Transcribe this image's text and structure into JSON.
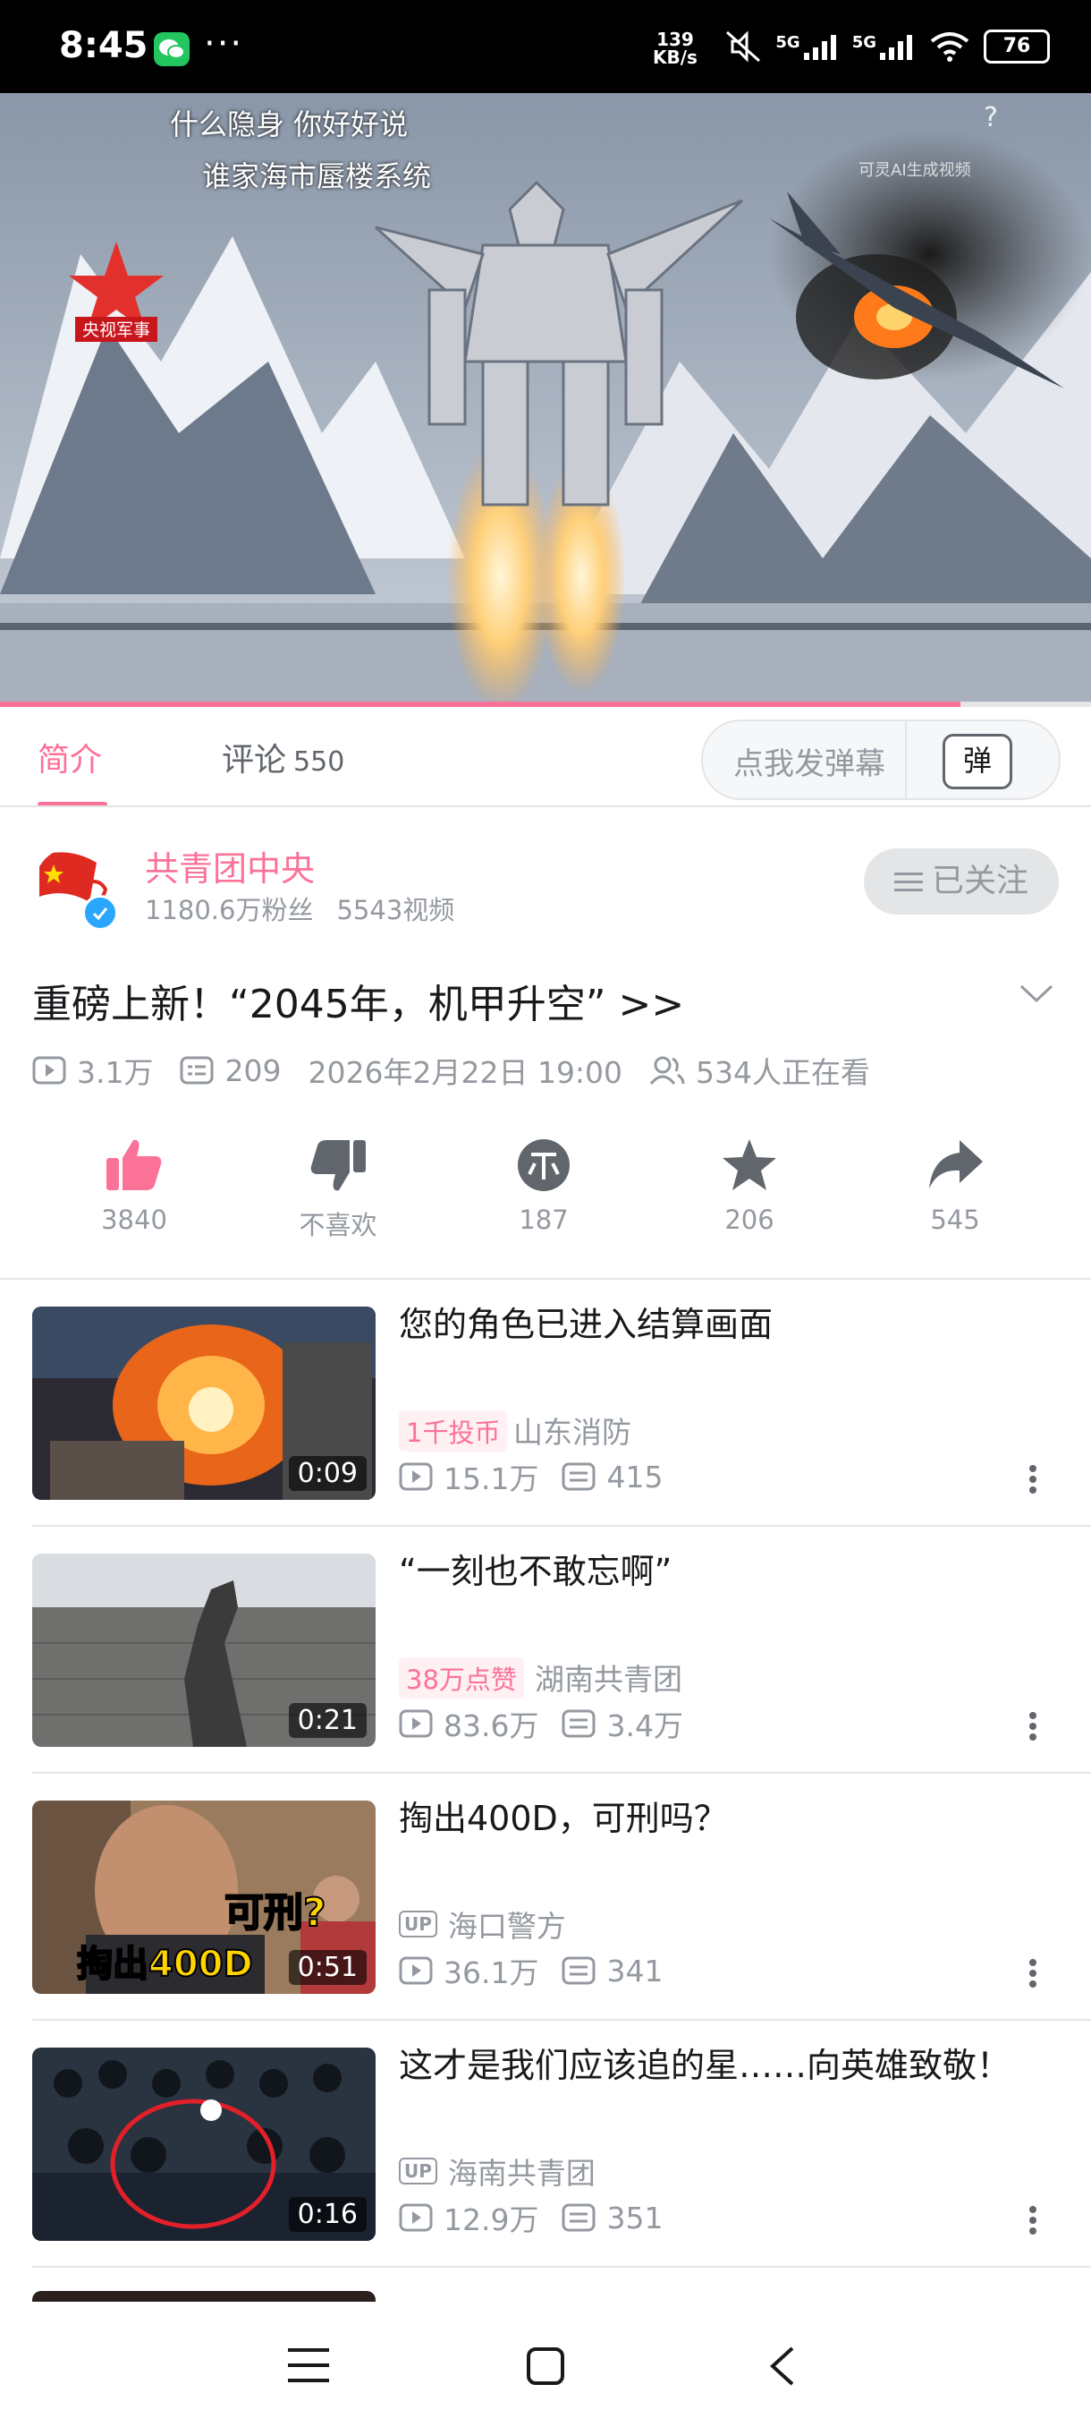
{
  "status_bar": {
    "time": "8:45",
    "more": "···",
    "net_speed_value": "139",
    "net_speed_unit": "KB/s",
    "signal_1": "5G",
    "signal_2": "5G",
    "battery": "76"
  },
  "video": {
    "caption_1": "什么隐身 你好好说",
    "caption_2": "谁家海市蜃楼系统",
    "channel_logo_text": "央视军事",
    "ai_notice": "可灵AI生成视频",
    "help": "?",
    "progress": 0.88
  },
  "tabs": {
    "intro": "简介",
    "comments": "评论",
    "comment_count": "550",
    "danmaku_placeholder": "点我发弹幕",
    "danmaku_button": "弹"
  },
  "uploader": {
    "name": "共青团中央",
    "fans": "1180.6万粉丝",
    "videos": "5543视频",
    "follow_label": "已关注"
  },
  "detail": {
    "title": "重磅上新！“2045年，机甲升空” >>",
    "views": "3.1万",
    "danmaku": "209",
    "date": "2026年2月22日 19:00",
    "watching": "534人正在看"
  },
  "actions": [
    {
      "label": "3840",
      "icon": "like-icon"
    },
    {
      "label": "不喜欢",
      "icon": "dislike-icon"
    },
    {
      "label": "187",
      "icon": "coin-icon"
    },
    {
      "label": "206",
      "icon": "star-icon"
    },
    {
      "label": "545",
      "icon": "share-icon"
    }
  ],
  "recommendations": [
    {
      "title": "您的角色已进入结算画面",
      "tag": "1千投币",
      "uploader": "山东消防",
      "views": "15.1万",
      "danmaku": "415",
      "duration": "0:09"
    },
    {
      "title": "“一刻也不敢忘啊”",
      "tag": "38万点赞",
      "uploader": "湖南共青团",
      "views": "83.6万",
      "danmaku": "3.4万",
      "duration": "0:21"
    },
    {
      "title": "掏出400D，可刑吗？",
      "uploader": "海口警方",
      "views": "36.1万",
      "danmaku": "341",
      "duration": "0:51",
      "thumb_text_1": "可刑?",
      "thumb_text_2": "掏出400D"
    },
    {
      "title": "这才是我们应该追的星……向英雄致敬！",
      "uploader": "海南共青团",
      "views": "12.9万",
      "danmaku": "351",
      "duration": "0:16"
    }
  ],
  "up_badge": "UP",
  "colors": {
    "accent": "#fb7299",
    "text_primary": "#18191c",
    "text_secondary": "#9499a0",
    "divider": "#e3e5e7"
  }
}
